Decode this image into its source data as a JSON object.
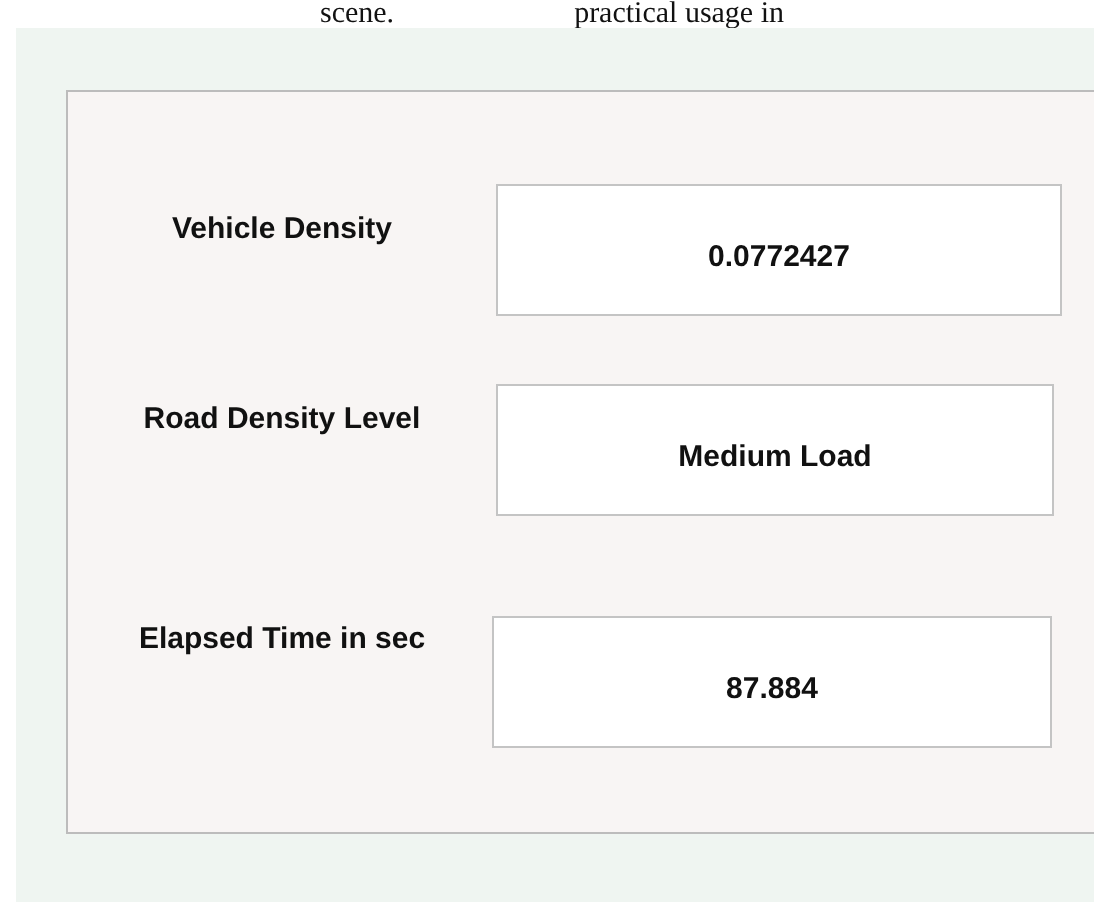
{
  "document_text": [
    {
      "text": "scene."
    },
    {
      "text": "practical usage in"
    }
  ],
  "panel": {
    "rows": [
      {
        "label": "Vehicle Density",
        "value": "0.0772427"
      },
      {
        "label": "Road Density Level",
        "value": "Medium Load"
      },
      {
        "label": "Elapsed Time in sec",
        "value": "87.884"
      }
    ]
  }
}
